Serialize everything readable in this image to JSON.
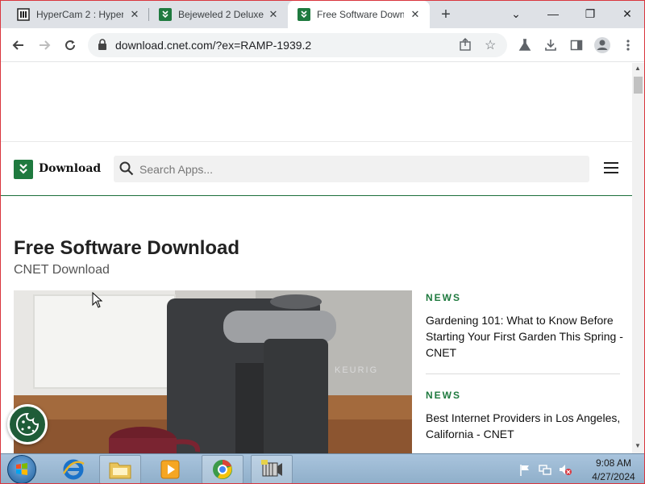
{
  "browser": {
    "tabs": [
      {
        "title": "HyperCam 2 : Hyper",
        "active": false
      },
      {
        "title": "Bejeweled 2 Deluxe",
        "active": false
      },
      {
        "title": "Free Software Down",
        "active": true
      }
    ],
    "new_tab_label": "+",
    "window_controls": {
      "minimize": "—",
      "restore": "❐",
      "close": "✕",
      "tab_search": "⌄"
    },
    "url": "download.cnet.com/?ex=RAMP-1939.2"
  },
  "site": {
    "logo_text": "Download",
    "search_placeholder": "Search Apps...",
    "page_title": "Free Software Download",
    "page_subtitle": "CNET Download",
    "news": [
      {
        "label": "NEWS",
        "title": "Gardening 101: What to Know Before Starting Your First Garden This Spring - CNET"
      },
      {
        "label": "NEWS",
        "title": "Best Internet Providers in Los Angeles, California - CNET"
      }
    ]
  },
  "taskbar": {
    "time": "9:08 AM",
    "date": "4/27/2024"
  },
  "colors": {
    "brand_green": "#1f7a3f",
    "tab_strip": "#dee1e6",
    "taskbar": "#9fbcd6"
  },
  "icons": [
    "back-icon",
    "forward-icon",
    "reload-icon",
    "lock-icon",
    "share-icon",
    "star-icon",
    "labs-icon",
    "download-icon",
    "sidepanel-icon",
    "profile-icon",
    "kebab-menu-icon",
    "search-icon",
    "hamburger-menu-icon",
    "cookie-icon"
  ]
}
